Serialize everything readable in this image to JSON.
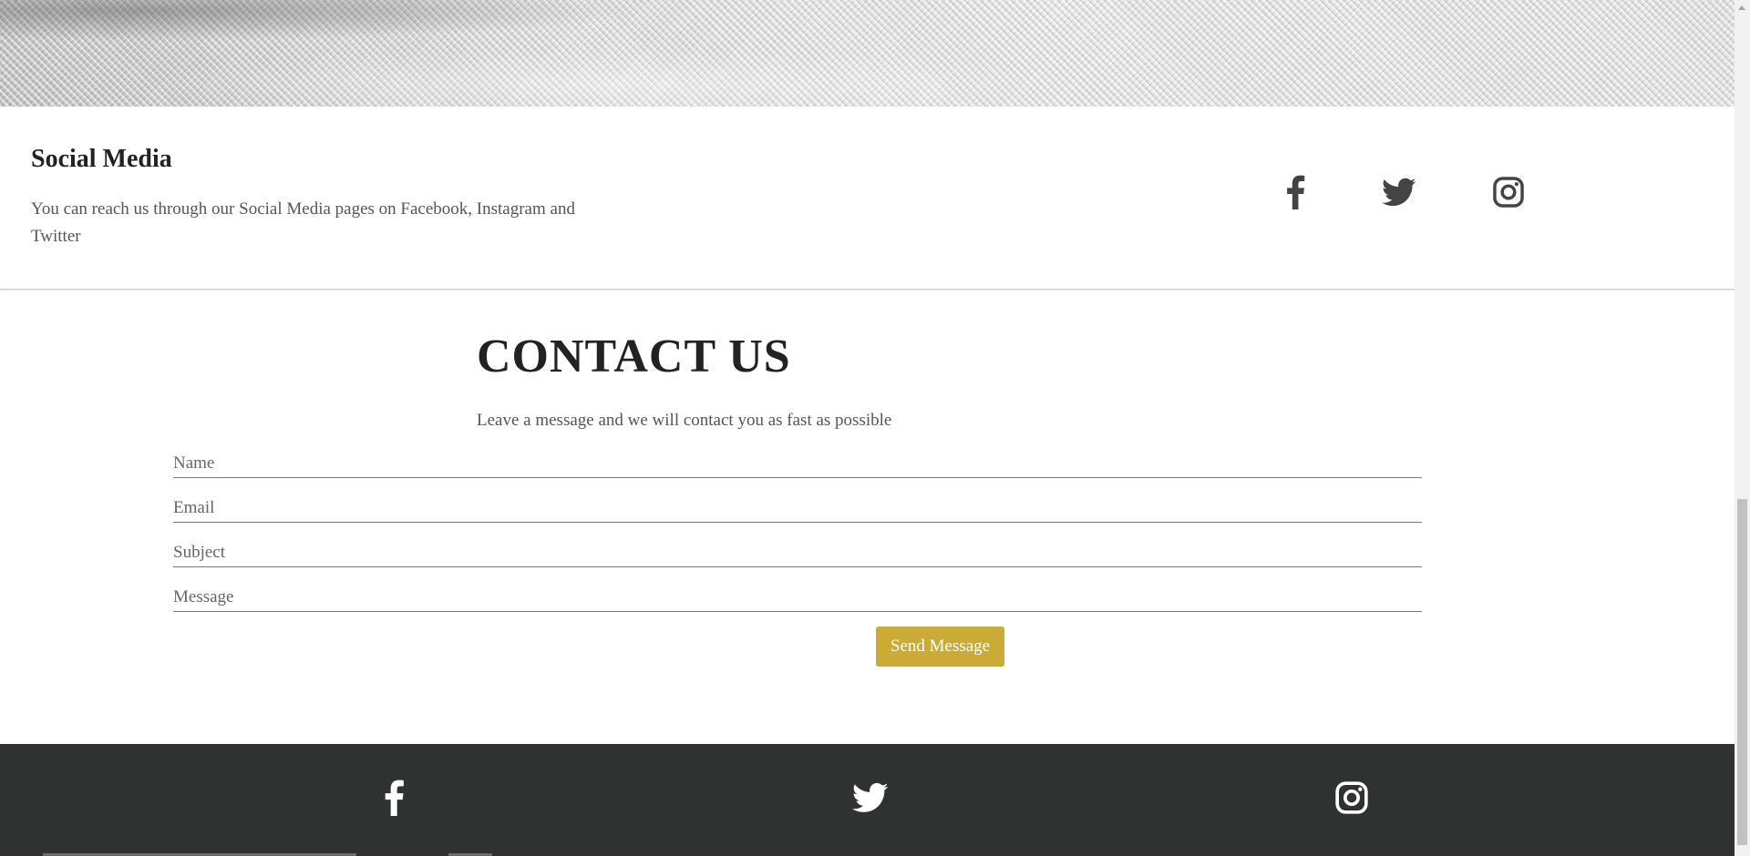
{
  "social": {
    "title": "Social Media",
    "description": "You can reach us through our Social Media pages on Facebook, Instagram and Twitter",
    "icons": [
      "facebook-icon",
      "twitter-icon",
      "instagram-icon"
    ]
  },
  "contact": {
    "title": "CONTACT US",
    "subtitle": "Leave a message and we will contact you as fast as possible",
    "fields": {
      "name_placeholder": "Name",
      "email_placeholder": "Email",
      "subject_placeholder": "Subject",
      "message_placeholder": "Message"
    },
    "send_label": "Send Message"
  },
  "footer": {
    "icons": [
      "facebook-icon",
      "twitter-icon",
      "instagram-icon"
    ]
  },
  "colors": {
    "accent": "#c9ab36",
    "footer_bg": "#303131",
    "heading": "#222222",
    "body_text": "#555555"
  }
}
